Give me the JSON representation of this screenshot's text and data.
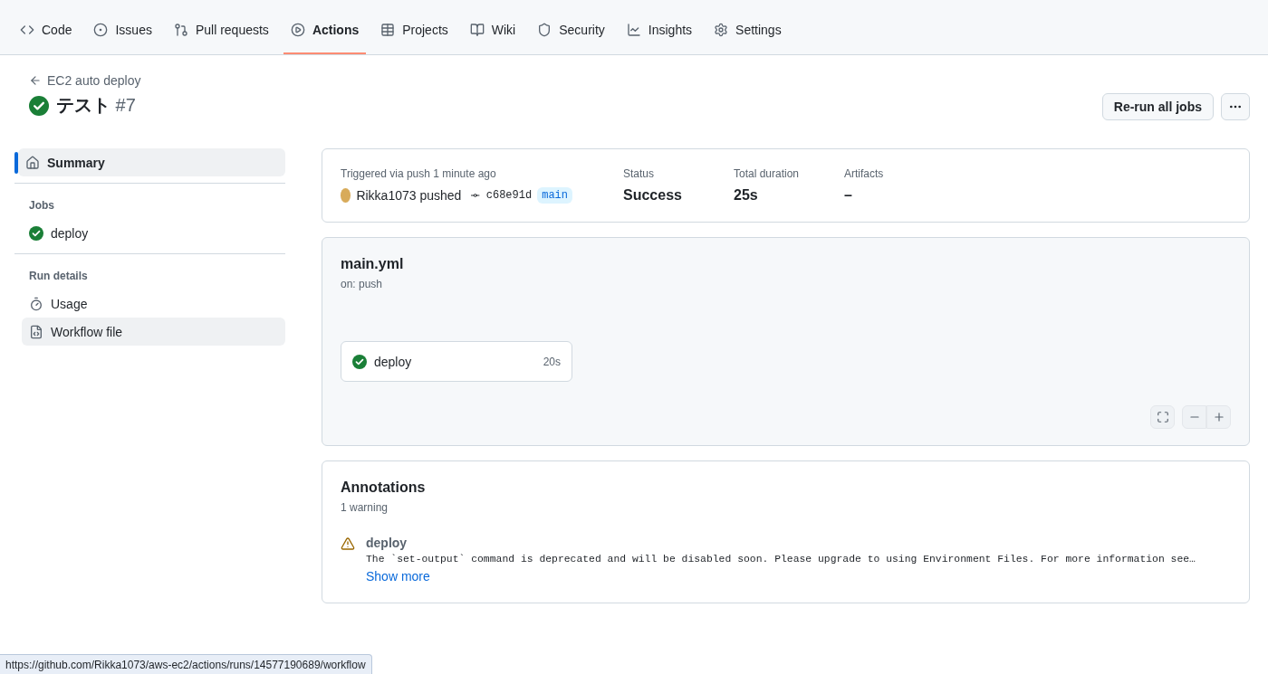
{
  "tabs": [
    {
      "label": "Code",
      "selected": false
    },
    {
      "label": "Issues",
      "selected": false
    },
    {
      "label": "Pull requests",
      "selected": false
    },
    {
      "label": "Actions",
      "selected": true
    },
    {
      "label": "Projects",
      "selected": false
    },
    {
      "label": "Wiki",
      "selected": false
    },
    {
      "label": "Security",
      "selected": false
    },
    {
      "label": "Insights",
      "selected": false
    },
    {
      "label": "Settings",
      "selected": false
    }
  ],
  "breadcrumb": "EC2 auto deploy",
  "title": {
    "name": "テスト",
    "number": "#7"
  },
  "actions": {
    "rerun": "Re-run all jobs"
  },
  "sidebar": {
    "summary": {
      "label": "Summary",
      "selected": true
    },
    "sections": [
      {
        "heading": "Jobs",
        "items": [
          {
            "label": "deploy",
            "kind": "job",
            "hovered": false
          }
        ]
      },
      {
        "heading": "Run details",
        "items": [
          {
            "label": "Usage",
            "kind": "link",
            "hovered": false
          },
          {
            "label": "Workflow file",
            "kind": "link",
            "hovered": true
          }
        ]
      }
    ]
  },
  "summary": {
    "trigger": "Triggered via push 1 minute ago",
    "actor": "Rikka1073 pushed",
    "commit": "c68e91d",
    "branch": "main",
    "stats": [
      {
        "label": "Status",
        "value": "Success"
      },
      {
        "label": "Total duration",
        "value": "25s"
      },
      {
        "label": "Artifacts",
        "value": "–"
      }
    ]
  },
  "graph": {
    "file": "main.yml",
    "trigger": "on: push",
    "jobs": [
      {
        "name": "deploy",
        "duration": "20s"
      }
    ]
  },
  "annotations": {
    "title": "Annotations",
    "count": "1 warning",
    "items": [
      {
        "kind": "warning",
        "job": "deploy",
        "message": "The `set-output` command is deprecated and will be disabled soon. Please upgrade to using Environment Files. For more information see…",
        "link": "Show more"
      }
    ]
  },
  "status_url": "https://github.com/Rikka1073/aws-ec2/actions/runs/14577190689/workflow"
}
